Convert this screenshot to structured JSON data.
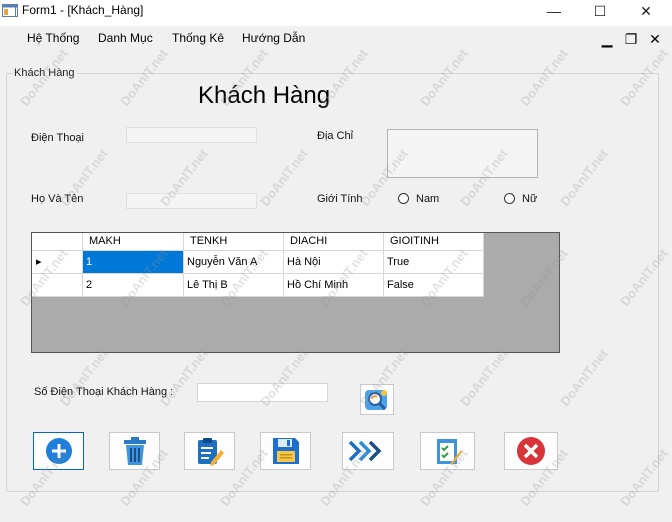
{
  "window": {
    "title": "Form1 - [Khách_Hàng]",
    "controls": {
      "minimize": "—",
      "maximize": "☐",
      "close": "✕"
    }
  },
  "menu": {
    "items": [
      "Hệ Thống",
      "Danh Mục",
      "Thống Kê",
      "Hướng Dẫn"
    ],
    "mdi_controls": {
      "minimize": "▁",
      "restore": "❐",
      "close": "✕"
    }
  },
  "form": {
    "group_label": "Khách Hàng",
    "title": "Khách Hàng",
    "phone_label": "Điện Thoại",
    "phone_value": "",
    "address_label": "Địa Chỉ",
    "address_value": "",
    "name_label": "Họ Và Tên",
    "name_value": "",
    "gender_label": "Giới Tính",
    "gender_options": [
      "Nam",
      "Nữ"
    ],
    "search_label": "Số Điện Thoại Khách Hàng :",
    "search_value": ""
  },
  "grid": {
    "columns": [
      "MAKH",
      "TENKH",
      "DIACHI",
      "GIOITINH"
    ],
    "rows": [
      [
        "1",
        "Nguyễn Văn A",
        "Hà Nội",
        "True"
      ],
      [
        "2",
        "Lê Thị B",
        "Hồ Chí Minh",
        "False"
      ]
    ],
    "current_row_marker": "▸"
  },
  "watermark": "DoAnIT.net",
  "icons": {
    "search": "search-refresh-icon",
    "add": "plus-circle-icon",
    "delete": "trash-icon",
    "edit": "clipboard-edit-icon",
    "save": "floppy-disk-icon",
    "next": "arrows-right-icon",
    "check": "checklist-icon",
    "cancel": "close-circle-icon"
  },
  "colors": {
    "selection": "#0078d7",
    "grid_bg": "#ababab",
    "add_blue": "#1f7fdb",
    "cancel_red": "#d9343a"
  }
}
